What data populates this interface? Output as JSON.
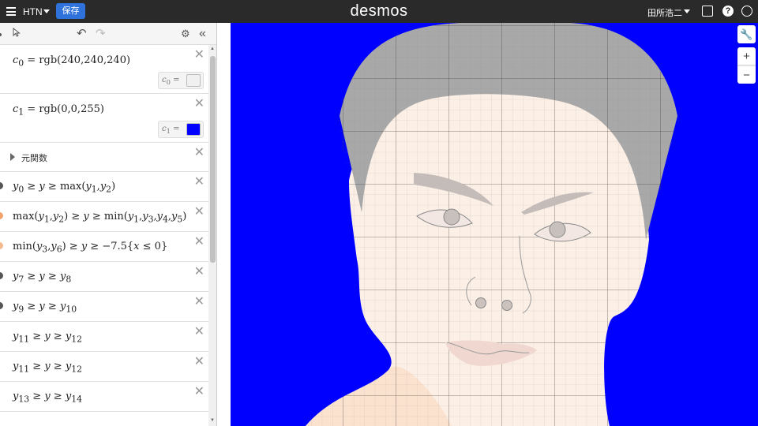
{
  "topbar": {
    "graph_title": "HTN",
    "save_label": "保存",
    "logo": "desmos",
    "user_name": "田所浩二",
    "help_glyph": "?",
    "icons": [
      "menu-icon",
      "share-icon",
      "help-icon",
      "globe-icon"
    ]
  },
  "toolbar": {
    "icons": [
      "pointer-icon",
      "undo-icon",
      "redo-icon",
      "gear-icon",
      "collapse-icon"
    ]
  },
  "expressions": [
    {
      "type": "color",
      "latex_html": "<i>c</i><sub>0</sub> = rgb(240,240,240)",
      "swatch_label_html": "<i>c</i><sub>0</sub> =",
      "swatch_color": "#f0f0f0"
    },
    {
      "type": "color",
      "latex_html": "<i>c</i><sub>1</sub> = rgb(0,0,255)",
      "swatch_label_html": "<i>c</i><sub>1</sub> =",
      "swatch_color": "#0000ff"
    },
    {
      "type": "folder",
      "label": "元関数"
    },
    {
      "type": "math",
      "latex_html": "<i>y</i><sub>0</sub> ≥ <i>y</i> ≥ max(<i>y</i><sub>1</sub>,<i>y</i><sub>2</sub>)",
      "dot_color": "#555555"
    },
    {
      "type": "math",
      "latex_html": "max(<i>y</i><sub>1</sub>,<i>y</i><sub>2</sub>) ≥ <i>y</i> ≥ min(<i>y</i><sub>1</sub>,<i>y</i><sub>3</sub>,<i>y</i><sub>4</sub>,<i>y</i><sub>5</sub>)",
      "dot_color": "#f3a26b"
    },
    {
      "type": "math",
      "latex_html": "min(<i>y</i><sub>3</sub>,<i>y</i><sub>6</sub>) ≥ <i>y</i> ≥ −7.5{<i>x</i> ≤ 0}",
      "dot_color": "#f6b98f"
    },
    {
      "type": "math",
      "latex_html": "<i>y</i><sub>7</sub> ≥ <i>y</i> ≥ <i>y</i><sub>8</sub>",
      "dot_color": "#555555"
    },
    {
      "type": "math",
      "latex_html": "<i>y</i><sub>9</sub> ≥ <i>y</i> ≥ <i>y</i><sub>10</sub>",
      "dot_color": "#555555"
    },
    {
      "type": "math",
      "latex_html": "<i>y</i><sub>11</sub> ≥ <i>y</i> ≥ <i>y</i><sub>12</sub>",
      "dot_color": ""
    },
    {
      "type": "math",
      "latex_html": "<i>y</i><sub>11</sub> ≥ <i>y</i> ≥ <i>y</i><sub>12</sub>",
      "dot_color": ""
    },
    {
      "type": "math",
      "latex_html": "<i>y</i><sub>13</sub> ≥ <i>y</i> ≥ <i>y</i><sub>14</sub>",
      "dot_color": ""
    }
  ],
  "graph": {
    "background_color": "#0000ff",
    "skin_color": "#fcefe6",
    "hair_color": "#a8a8a8",
    "grid_color": "#555555",
    "zoom_in_label": "+",
    "zoom_out_label": "−"
  }
}
